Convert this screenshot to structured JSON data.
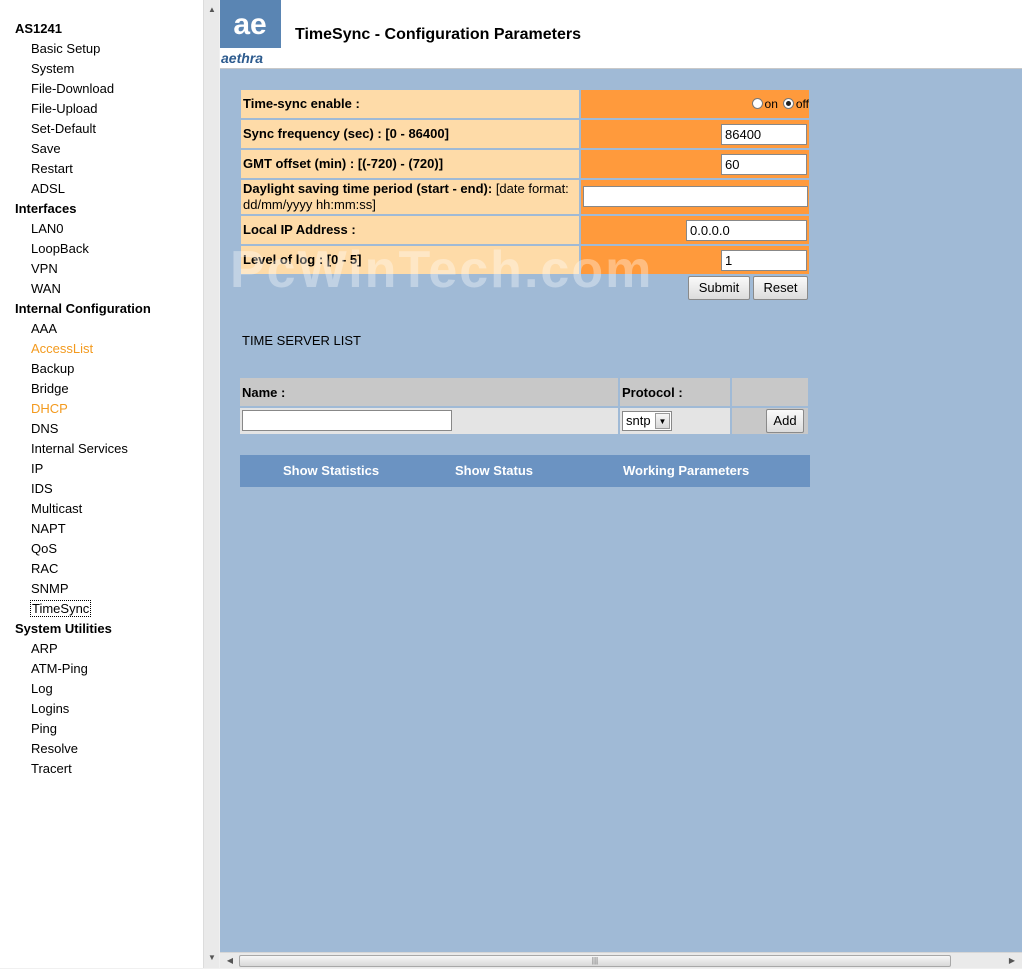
{
  "menu": {
    "groups": [
      {
        "title": "AS1241",
        "items": [
          "Basic Setup",
          "System",
          "File-Download",
          "File-Upload",
          "Set-Default",
          "Save",
          "Restart",
          "ADSL"
        ]
      },
      {
        "title": "Interfaces",
        "items": [
          "LAN0",
          "LoopBack",
          "VPN",
          "WAN"
        ]
      },
      {
        "title": "Internal Configuration",
        "items": [
          "AAA",
          "AccessList",
          "Backup",
          "Bridge",
          "DHCP",
          "DNS",
          "Internal Services",
          "IP",
          "IDS",
          "Multicast",
          "NAPT",
          "QoS",
          "RAC",
          "SNMP",
          "TimeSync"
        ]
      },
      {
        "title": "System Utilities",
        "items": [
          "ARP",
          "ATM-Ping",
          "Log",
          "Logins",
          "Ping",
          "Resolve",
          "Tracert"
        ]
      }
    ],
    "highlighted_items": [
      "AccessList",
      "DHCP"
    ],
    "selected_item": "TimeSync",
    "highlight_color": "#f39a1e"
  },
  "header": {
    "logo_text": "aethra",
    "logo_mark": "ae",
    "title": "TimeSync - Configuration Parameters"
  },
  "config": {
    "timesync_enable": {
      "label": "Time-sync enable :",
      "on_label": "on",
      "off_label": "off",
      "selected": "off"
    },
    "sync_frequency": {
      "label": "Sync frequency (sec) : [0 - 86400]",
      "value": "86400"
    },
    "gmt_offset": {
      "label": "GMT offset (min) : [(-720) - (720)]",
      "value": "60"
    },
    "daylight": {
      "label_bold": "Daylight saving time period (start - end):",
      "label_normal": " [date format: dd/mm/yyyy hh:mm:ss]",
      "value": ""
    },
    "local_ip": {
      "label": "Local IP Address :",
      "value": "0.0.0.0"
    },
    "log_level": {
      "label": "Level of log : [0 - 5]",
      "value": "1"
    },
    "submit_label": "Submit",
    "reset_label": "Reset"
  },
  "server_list": {
    "title": "TIME SERVER LIST",
    "name_header": "Name :",
    "protocol_header": "Protocol :",
    "name_value": "",
    "protocol_value": "sntp",
    "add_label": "Add"
  },
  "nav": {
    "show_statistics": "Show Statistics",
    "show_status": "Show Status",
    "working_parameters": "Working Parameters"
  },
  "watermark": "PcWinTech.com",
  "colors": {
    "label_bg": "#fedba8",
    "value_bg": "#ff9a3c",
    "main_bg": "#a0bad6",
    "nav_bg": "#6b93c2"
  }
}
